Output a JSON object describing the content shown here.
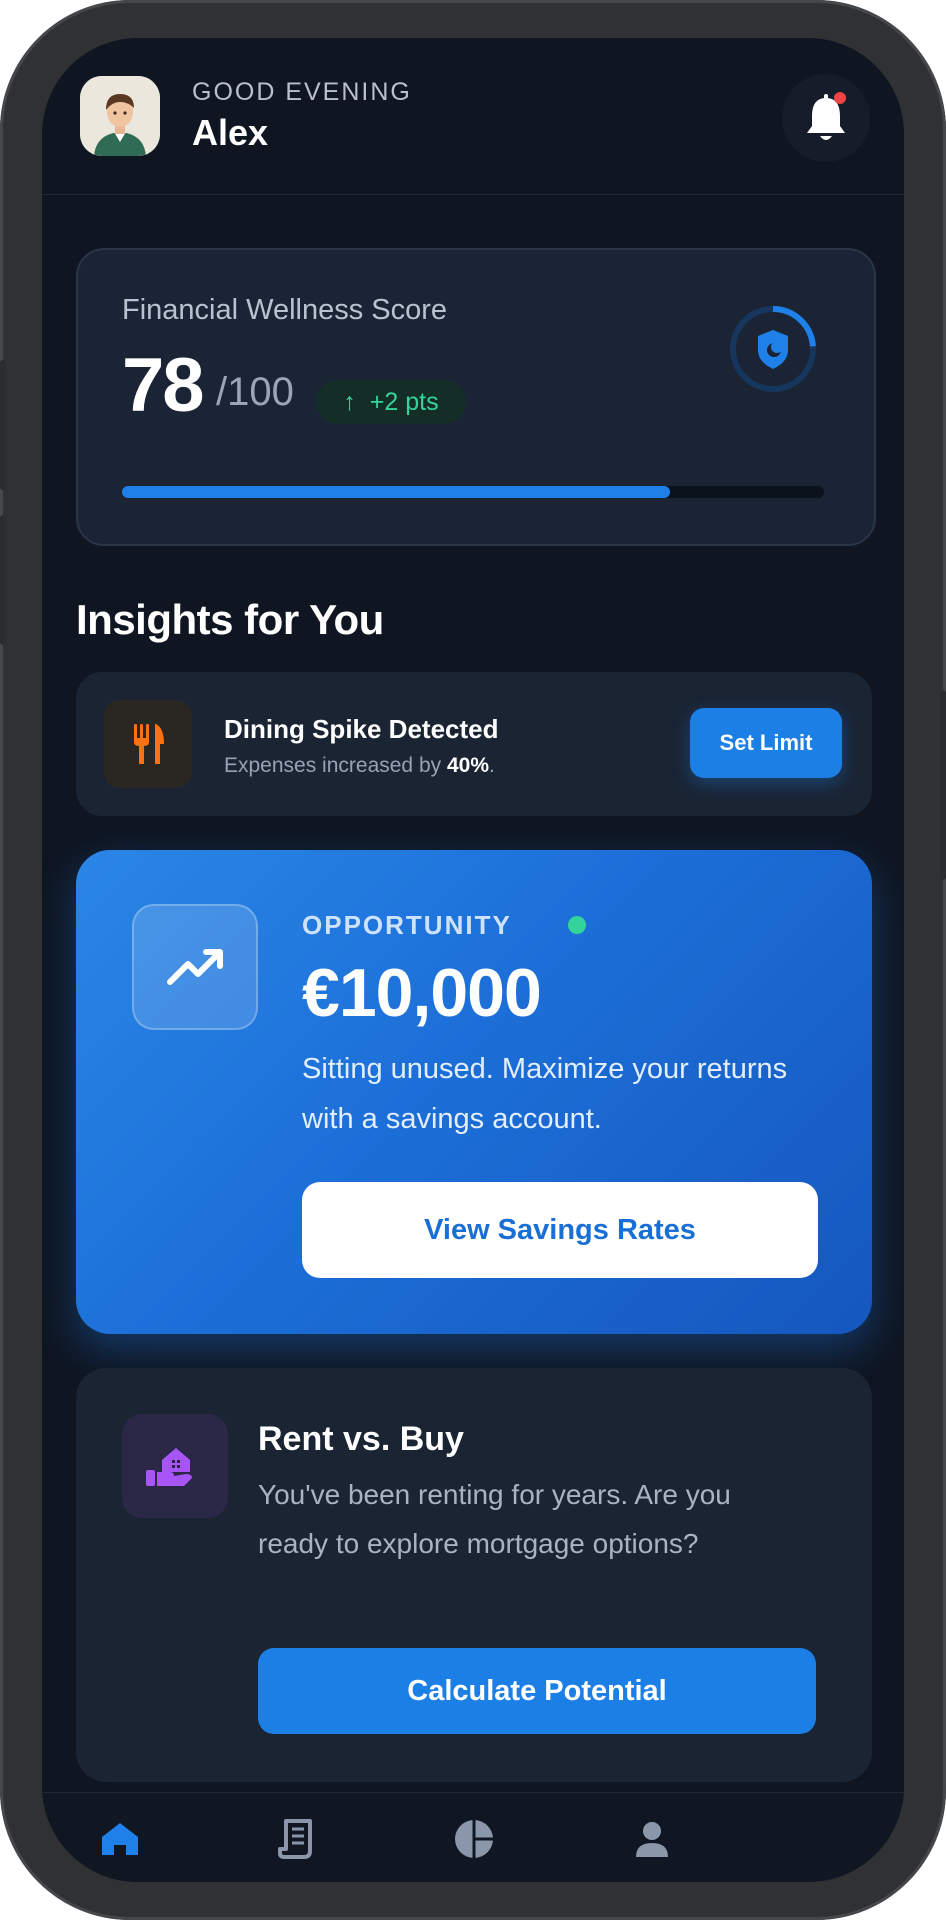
{
  "header": {
    "greeting": "GOOD EVENING",
    "user_name": "Alex",
    "avatar_icon": "user-avatar",
    "notification_icon": "bell-icon",
    "has_unread": true
  },
  "wellness": {
    "title": "Financial Wellness Score",
    "score": "78",
    "total": "/100",
    "change": "+2 pts",
    "progress": 0.78,
    "badge_icon": "shield-icon"
  },
  "insights": {
    "section_title": "Insights for You",
    "dining": {
      "title": "Dining Spike Detected",
      "subtitle_prefix": "Expenses increased by ",
      "subtitle_value": "40%",
      "subtitle_suffix": ".",
      "button": "Set Limit",
      "icon": "utensils-icon"
    },
    "opportunity": {
      "label": "OPPORTUNITY",
      "amount": "€10,000",
      "description": "Sitting unused. Maximize your returns with a savings account.",
      "button": "View Savings Rates",
      "icon": "trending-up-icon"
    },
    "rent": {
      "title": "Rent vs. Buy",
      "description": "You've been renting for years. Are you ready to explore mortgage options?",
      "button": "Calculate Potential",
      "icon": "house-hand-icon"
    }
  },
  "nav": {
    "items": [
      {
        "icon": "home-icon",
        "active": true
      },
      {
        "icon": "receipt-icon",
        "active": false
      },
      {
        "icon": "pie-chart-icon",
        "active": false
      },
      {
        "icon": "profile-icon",
        "active": false
      }
    ]
  },
  "colors": {
    "accent": "#1c7fe6",
    "background": "#0f1622",
    "card": "#1a2433",
    "positive": "#34d399",
    "alert": "#ef4444"
  }
}
